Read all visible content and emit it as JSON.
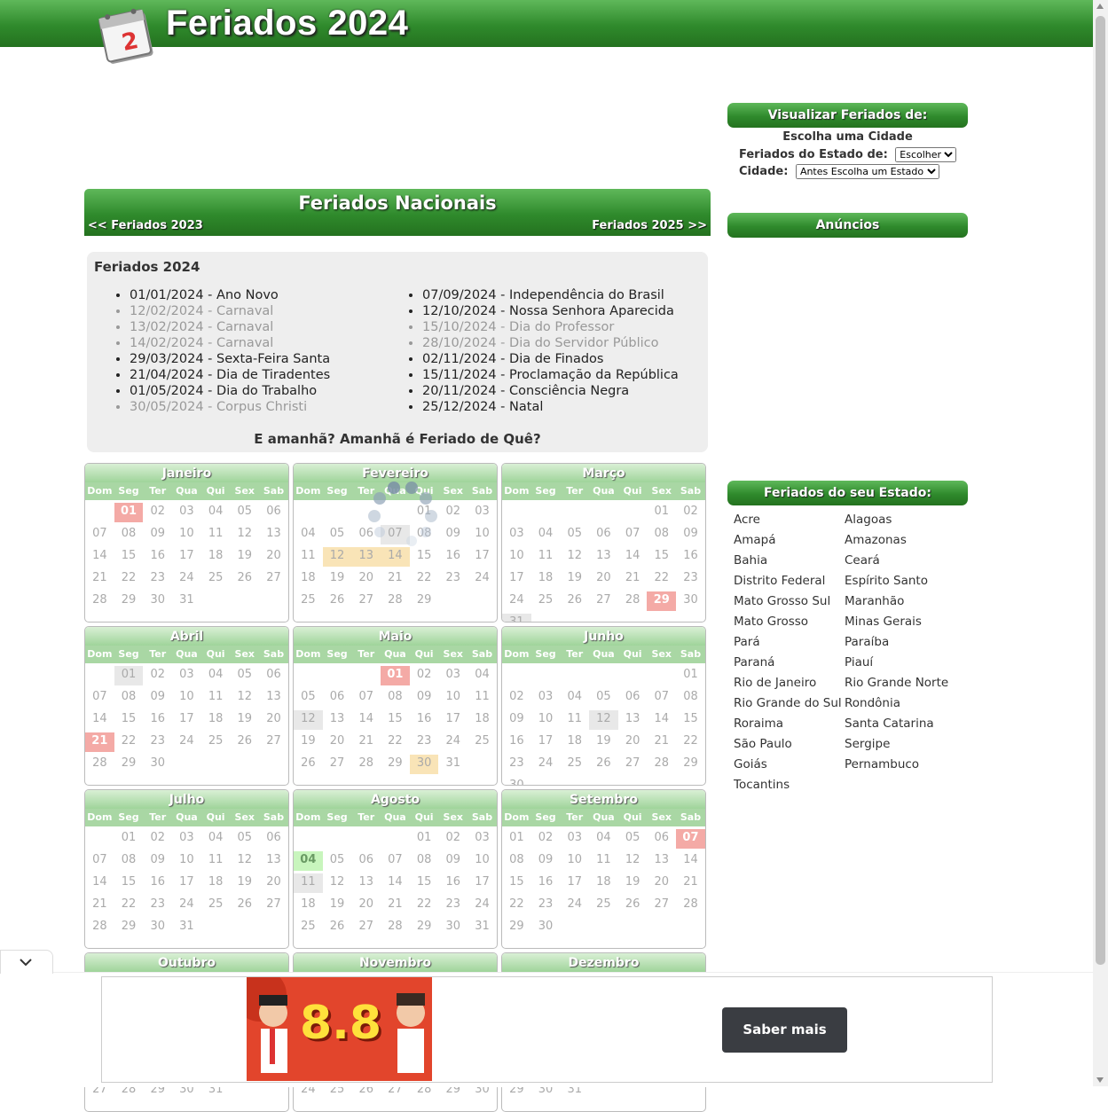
{
  "header": {
    "title": "Feriados 2024"
  },
  "national": {
    "title": "Feriados Nacionais",
    "prev_link": "<< Feriados 2023",
    "next_link": "Feriados 2025 >>",
    "list_title": "Feriados 2024",
    "left": [
      {
        "text": "01/01/2024 - Ano Novo",
        "optional": false
      },
      {
        "text": "12/02/2024 - Carnaval",
        "optional": true
      },
      {
        "text": "13/02/2024 - Carnaval",
        "optional": true
      },
      {
        "text": "14/02/2024 - Carnaval",
        "optional": true
      },
      {
        "text": "29/03/2024 - Sexta-Feira Santa",
        "optional": false
      },
      {
        "text": "21/04/2024 - Dia de Tiradentes",
        "optional": false
      },
      {
        "text": "01/05/2024 - Dia do Trabalho",
        "optional": false
      },
      {
        "text": "30/05/2024 - Corpus Christi",
        "optional": true
      }
    ],
    "right": [
      {
        "text": "07/09/2024 - Independência do Brasil",
        "optional": false
      },
      {
        "text": "12/10/2024 - Nossa Senhora Aparecida",
        "optional": false
      },
      {
        "text": "15/10/2024 - Dia do Professor",
        "optional": true
      },
      {
        "text": "28/10/2024 - Dia do Servidor Público",
        "optional": true
      },
      {
        "text": "02/11/2024 - Dia de Finados",
        "optional": false
      },
      {
        "text": "15/11/2024 - Proclamação da República",
        "optional": false
      },
      {
        "text": "20/11/2024 - Consciência Negra",
        "optional": false
      },
      {
        "text": "25/12/2024 - Natal",
        "optional": false
      }
    ],
    "tomorrow": "E amanhã? Amanhã é Feriado de Quê?"
  },
  "weekdays": [
    "Dom",
    "Seg",
    "Ter",
    "Qua",
    "Qui",
    "Sex",
    "Sab"
  ],
  "months": [
    {
      "name": "Janeiro",
      "offset": 1,
      "days": 31,
      "marks": {
        "1": "nat"
      }
    },
    {
      "name": "Fevereiro",
      "offset": 4,
      "days": 29,
      "marks": {
        "7": "today",
        "12": "opt",
        "13": "opt",
        "14": "opt"
      }
    },
    {
      "name": "Março",
      "offset": 5,
      "days": 31,
      "marks": {
        "29": "nat",
        "31": "today"
      }
    },
    {
      "name": "Abril",
      "offset": 1,
      "days": 30,
      "marks": {
        "1": "today",
        "21": "nat"
      }
    },
    {
      "name": "Maio",
      "offset": 3,
      "days": 31,
      "marks": {
        "1": "nat",
        "12": "today",
        "30": "opt"
      }
    },
    {
      "name": "Junho",
      "offset": 6,
      "days": 30,
      "marks": {
        "12": "today"
      }
    },
    {
      "name": "Julho",
      "offset": 1,
      "days": 31,
      "marks": {}
    },
    {
      "name": "Agosto",
      "offset": 4,
      "days": 31,
      "marks": {
        "4": "state",
        "11": "today"
      }
    },
    {
      "name": "Setembro",
      "offset": 0,
      "days": 30,
      "marks": {
        "7": "nat"
      }
    },
    {
      "name": "Outubro",
      "offset": 2,
      "days": 31,
      "marks": {}
    },
    {
      "name": "Novembro",
      "offset": 5,
      "days": 30,
      "marks": {}
    },
    {
      "name": "Dezembro",
      "offset": 0,
      "days": 31,
      "marks": {}
    }
  ],
  "sidebar": {
    "view_title": "Visualizar Feriados de:",
    "choose_city": "Escolha uma Cidade",
    "state_label": "Feriados do Estado de:",
    "state_selected": "Escolher",
    "city_label": "Cidade:",
    "city_selected": "Antes Escolha um Estado",
    "ads_title": "Anúncios",
    "states_title": "Feriados do seu Estado:",
    "states": [
      "Acre",
      "Alagoas",
      "Amapá",
      "Amazonas",
      "Bahia",
      "Ceará",
      "Distrito Federal",
      "Espírito Santo",
      "Mato Grosso Sul",
      "Maranhão",
      "Mato Grosso",
      "Minas Gerais",
      "Pará",
      "Paraíba",
      "Paraná",
      "Piauí",
      "Rio de Janeiro",
      "Rio Grande Norte",
      "Rio Grande do Sul",
      "Rondônia",
      "Roraima",
      "Santa Catarina",
      "São Paulo",
      "Sergipe",
      "Goiás",
      "Pernambuco",
      "Tocantins"
    ]
  },
  "ad": {
    "headline": "8.8",
    "cta": "Saber mais"
  },
  "colors": {
    "green_dark": "#24721f",
    "green_light": "#5fb85a",
    "holiday_red": "#f4aaa6",
    "optional_yellow": "#f9e4b7",
    "state_green": "#c8f5bd"
  }
}
